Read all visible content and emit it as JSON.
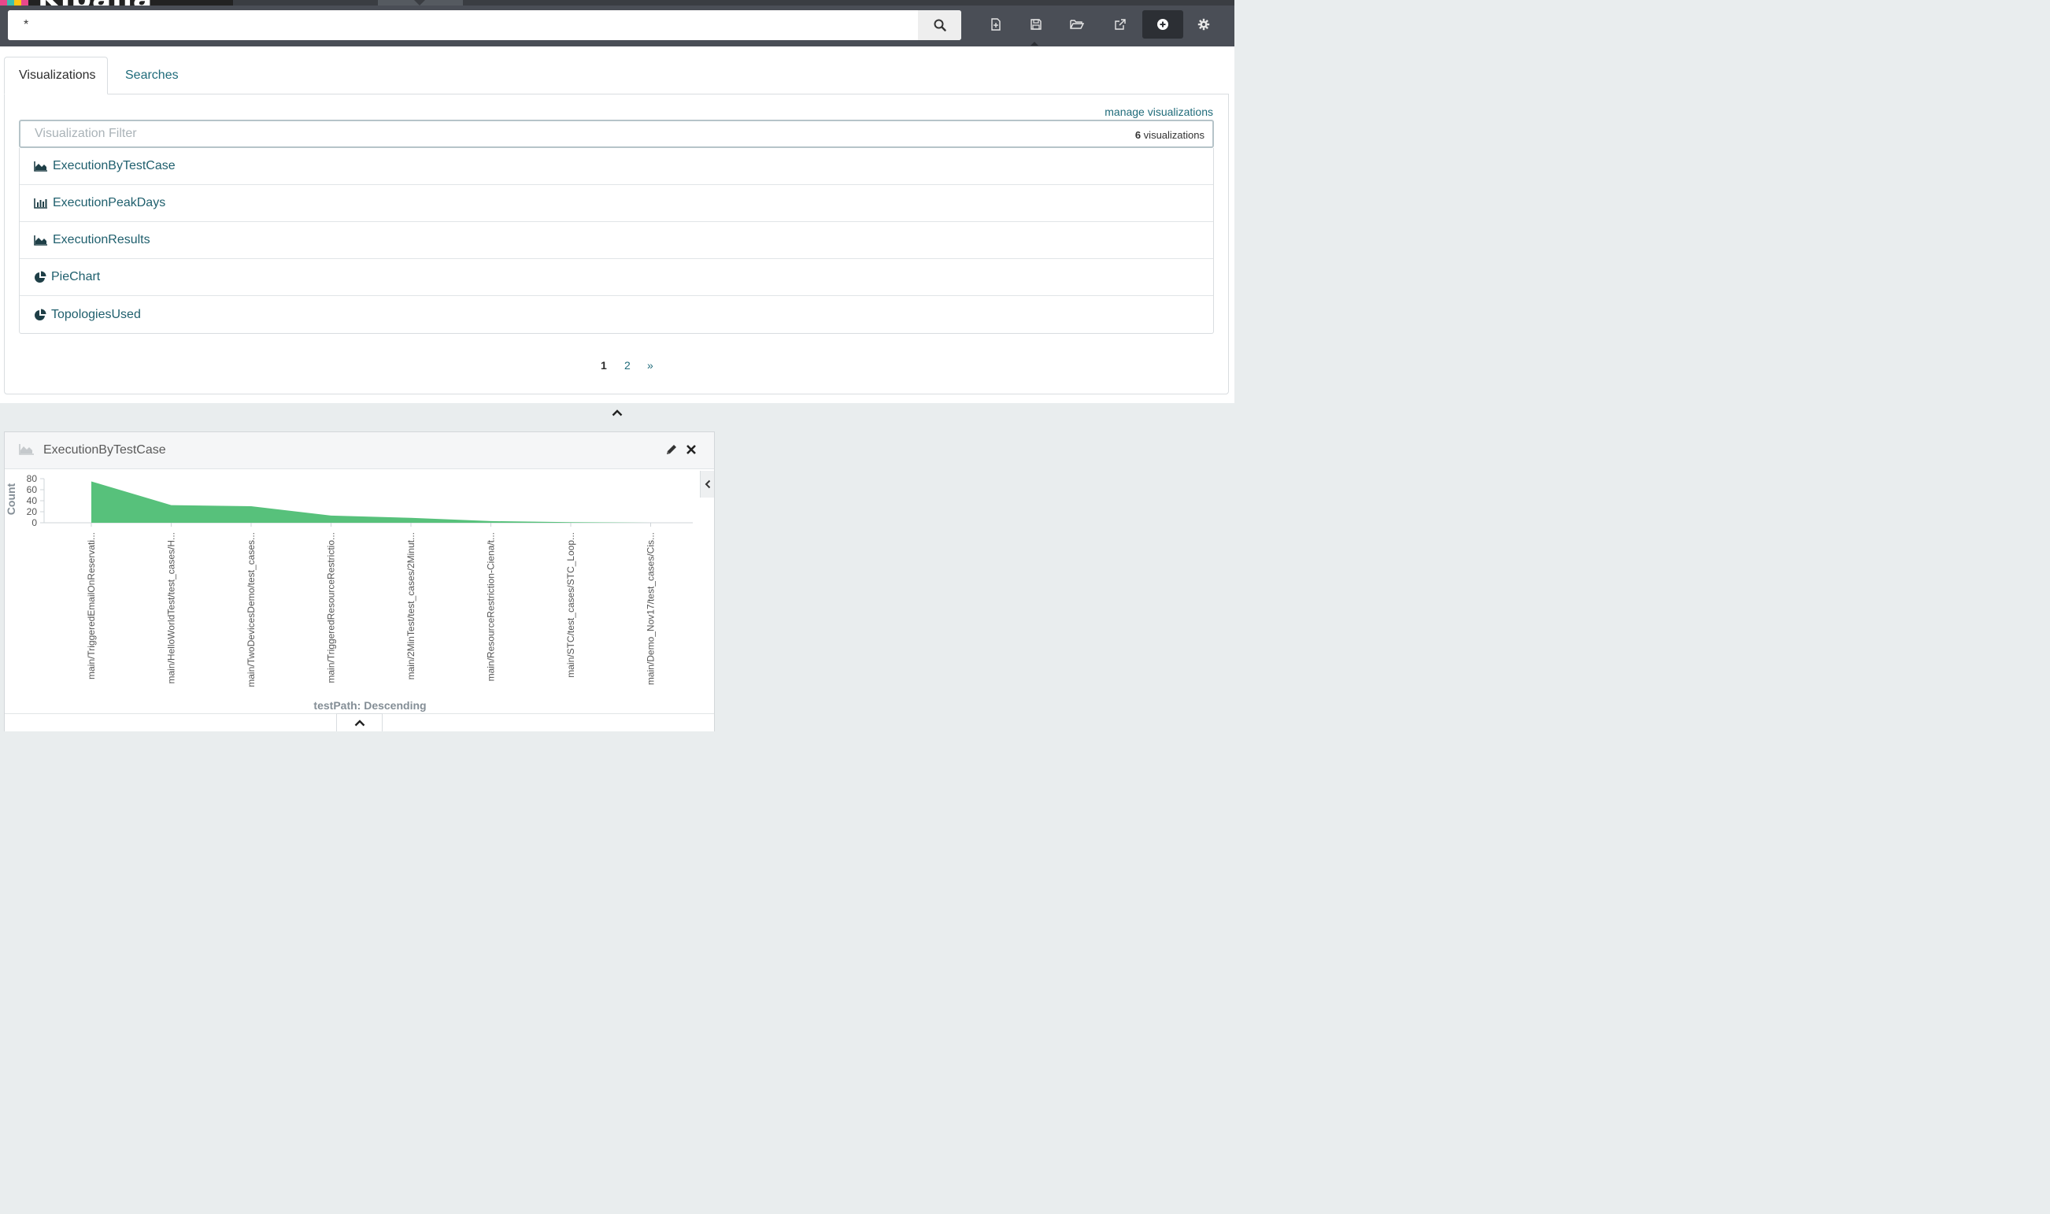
{
  "app": {
    "query": "*",
    "colors": {
      "header": "#4a4e56",
      "accent": "#1f6b7a",
      "area": "#57c17b"
    },
    "toolbar": [
      {
        "name": "new-dashboard-icon",
        "active": false
      },
      {
        "name": "save-icon",
        "active": false
      },
      {
        "name": "open-folder-icon",
        "active": false
      },
      {
        "name": "share-icon",
        "active": false
      },
      {
        "name": "add-icon",
        "active": true
      },
      {
        "name": "settings-gear-icon",
        "active": false
      }
    ]
  },
  "picker": {
    "tabs": [
      "Visualizations",
      "Searches"
    ],
    "manage_link": "manage visualizations",
    "filter_placeholder": "Visualization Filter",
    "count_number": "6",
    "count_label": " visualizations",
    "items": [
      {
        "label": "ExecutionByTestCase",
        "icon": "area-chart-icon"
      },
      {
        "label": "ExecutionPeakDays",
        "icon": "bar-chart-icon"
      },
      {
        "label": "ExecutionResults",
        "icon": "area-chart-icon"
      },
      {
        "label": "PieChart",
        "icon": "pie-chart-icon"
      },
      {
        "label": "TopologiesUsed",
        "icon": "pie-chart-icon"
      }
    ],
    "pagination": {
      "current": "1",
      "next_page": "2",
      "next": "»"
    }
  },
  "panel": {
    "title": "ExecutionByTestCase",
    "icon": "area-chart-icon"
  },
  "chart_data": {
    "type": "area",
    "ylabel": "Count",
    "xlabel": "testPath: Descending",
    "ylim": [
      0,
      80
    ],
    "y_ticks": [
      0,
      20,
      40,
      60,
      80
    ],
    "grid": false,
    "categories": [
      "main/TriggeredEmailOnReservati...",
      "main/HelloWorldTest/test_cases/H...",
      "main/TwoDevicesDemo/test_cases...",
      "main/TriggeredResourceRestrictio...",
      "main/2MinTest/test_cases/2Minut...",
      "main/ResourceRestriction-Ciena/t...",
      "main/STC/test_cases/STC_Loop...",
      "main/Demo_Nov17/test_cases/Cis..."
    ],
    "values": [
      75,
      32,
      30,
      13,
      9,
      3,
      1,
      0
    ],
    "color": "#57c17b"
  }
}
